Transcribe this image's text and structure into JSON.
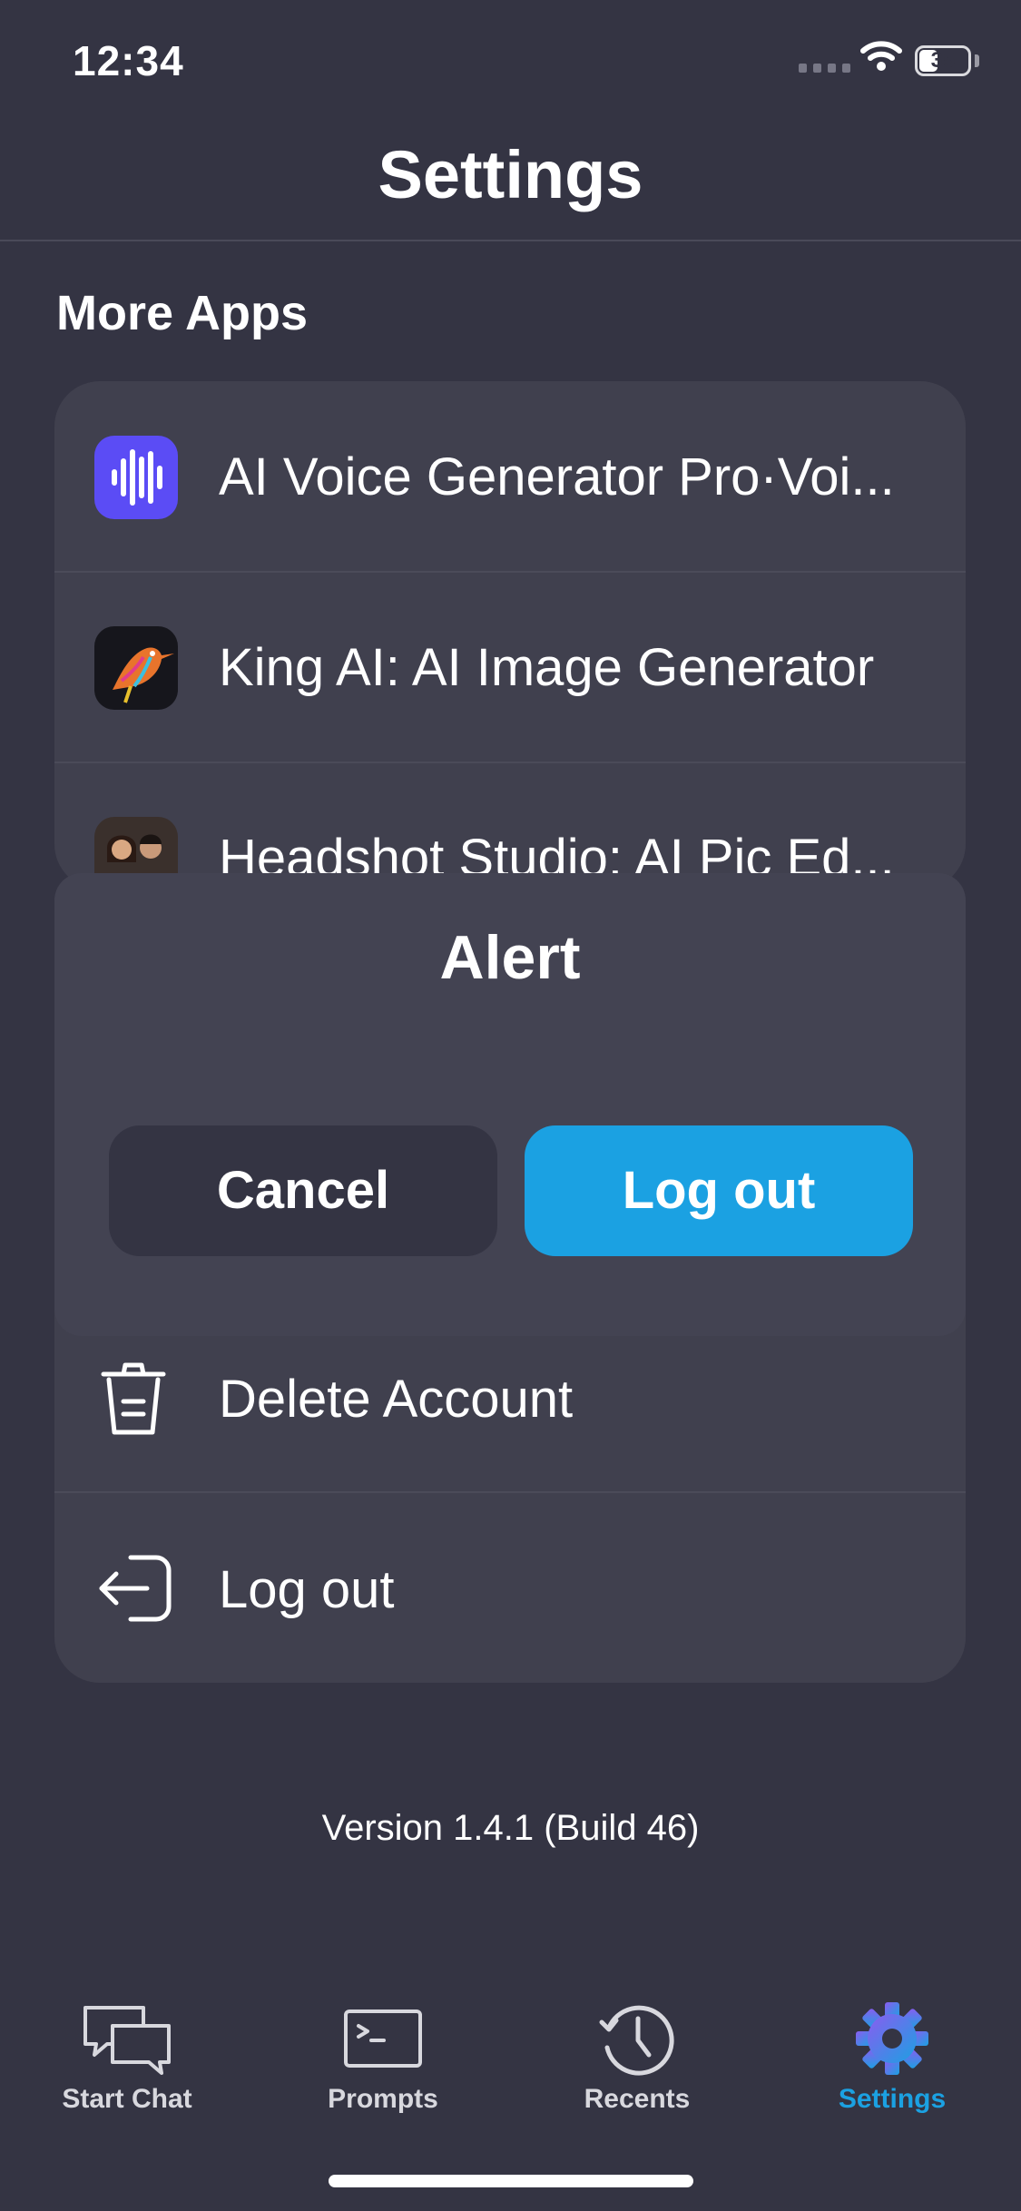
{
  "status_bar": {
    "time": "12:34",
    "battery": "35"
  },
  "header": {
    "title": "Settings"
  },
  "more_apps": {
    "title": "More Apps",
    "items": [
      {
        "label": "AI Voice Generator Pro·Voi...",
        "icon": "voice-waveform-icon",
        "icon_color": "#5b4cf5"
      },
      {
        "label": "King AI: AI Image Generator",
        "icon": "hummingbird-art-icon"
      },
      {
        "label": "Headshot Studio: AI Pic Ed...",
        "icon": "couple-portrait-icon"
      }
    ]
  },
  "alert": {
    "title": "Alert",
    "cancel_label": "Cancel",
    "confirm_label": "Log out",
    "confirm_color": "#1ba1e2"
  },
  "account": {
    "items": [
      {
        "label": "Delete Account",
        "icon": "trash-icon"
      },
      {
        "label": "Log out",
        "icon": "logout-icon"
      }
    ]
  },
  "version_text": "Version 1.4.1 (Build 46)",
  "tabs": [
    {
      "label": "Start Chat",
      "icon": "chat-bubbles-icon",
      "active": false
    },
    {
      "label": "Prompts",
      "icon": "terminal-icon",
      "active": false
    },
    {
      "label": "Recents",
      "icon": "history-clock-icon",
      "active": false
    },
    {
      "label": "Settings",
      "icon": "gear-icon",
      "active": true
    }
  ],
  "colors": {
    "background": "#343443",
    "card": "#40404e",
    "accent": "#1ba1e2"
  }
}
